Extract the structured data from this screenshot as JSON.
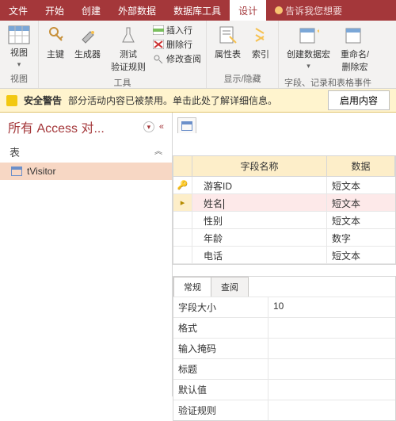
{
  "tabs": {
    "items": [
      "文件",
      "开始",
      "创建",
      "外部数据",
      "数据库工具",
      "设计"
    ],
    "active": 5,
    "tellme": "告诉我您想要"
  },
  "ribbon": {
    "g1": {
      "view": "视图",
      "label": "视图"
    },
    "g2": {
      "pk": "主键",
      "builder": "生成器",
      "test": "测试\n验证规则",
      "label": "工具",
      "insert": "插入行",
      "delete": "删除行",
      "modify": "修改查阅"
    },
    "g3": {
      "sheet": "属性表",
      "index": "索引",
      "label": "显示/隐藏"
    },
    "g4": {
      "macro": "创建数据宏",
      "rename": "重命名/\n删除宏",
      "label": "字段、记录和表格事件"
    }
  },
  "warn": {
    "title": "安全警告",
    "msg": "部分活动内容已被禁用。单击此处了解详细信息。",
    "btn": "启用内容"
  },
  "nav": {
    "title": "所有 Access 对...",
    "section": "表",
    "item": "tVisitor"
  },
  "design": {
    "head_name": "字段名称",
    "head_type": "数据",
    "rows": [
      {
        "name": "游客ID",
        "type": "短文本"
      },
      {
        "name": "姓名",
        "type": "短文本",
        "active": true
      },
      {
        "name": "性别",
        "type": "短文本"
      },
      {
        "name": "年龄",
        "type": "数字"
      },
      {
        "name": "电话",
        "type": "短文本"
      }
    ]
  },
  "props": {
    "tabs": [
      "常规",
      "查阅"
    ],
    "rows": [
      {
        "label": "字段大小",
        "val": "10"
      },
      {
        "label": "格式",
        "val": ""
      },
      {
        "label": "输入掩码",
        "val": ""
      },
      {
        "label": "标题",
        "val": ""
      },
      {
        "label": "默认值",
        "val": ""
      },
      {
        "label": "验证规则",
        "val": ""
      }
    ]
  }
}
